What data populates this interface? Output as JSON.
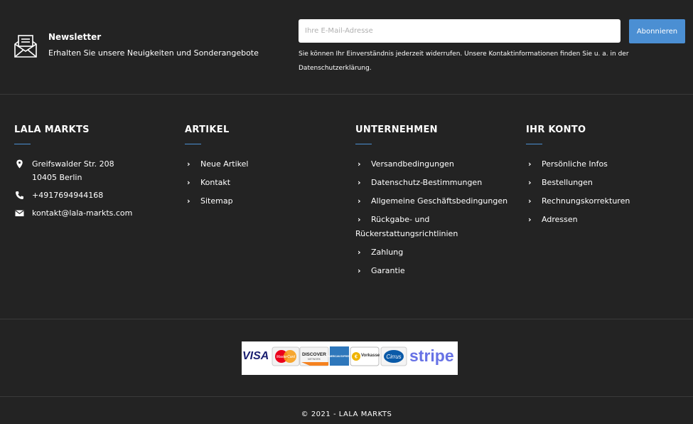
{
  "newsletter": {
    "icon": "envelope-open-icon",
    "title": "Newsletter",
    "subtitle": "Erhalten Sie unsere Neuigkeiten und Sonderangebote",
    "email_placeholder": "Ihre E-Mail-Adresse",
    "subscribe_label": "Abonnieren",
    "consent_text": "Sie können Ihr Einverständnis jederzeit widerrufen. Unsere Kontaktinformationen finden Sie u. a. in der Datenschutzerklärung."
  },
  "store": {
    "title": "LALA MARKTS",
    "address_line1": "Greifswalder Str. 208",
    "address_line2": "10405 Berlin",
    "phone": "+4917694944168",
    "email": "kontakt@lala-markts.com"
  },
  "artikel": {
    "title": "ARTIKEL",
    "items": [
      "Neue Artikel",
      "Kontakt",
      "Sitemap"
    ]
  },
  "unternehmen": {
    "title": "UNTERNEHMEN",
    "items": [
      "Versandbedingungen",
      "Datenschutz-Bestimmungen",
      "Allgemeine Geschäftsbedingungen",
      "Rückgabe- und Rückerstattungsrichtlinien",
      "Zahlung",
      "Garantie"
    ]
  },
  "konto": {
    "title": "IHR KONTO",
    "items": [
      "Persönliche Infos",
      "Bestellungen",
      "Rechnungskorrekturen",
      "Adressen"
    ]
  },
  "payments": {
    "visa": "VISA",
    "mastercard": "MasterCard",
    "discover": "DISCOVER",
    "discover_sub": "NETWORK",
    "amex": "AMERICAN EXPRESS",
    "vorkasse": "Vorkasse",
    "cirrus": "Cirrus",
    "stripe": "stripe"
  },
  "colors": {
    "background": "#232323",
    "accent": "#4b8fd3",
    "divider": "#3a3a3a"
  },
  "copyright": "© 2021 - LALA MARKTS"
}
